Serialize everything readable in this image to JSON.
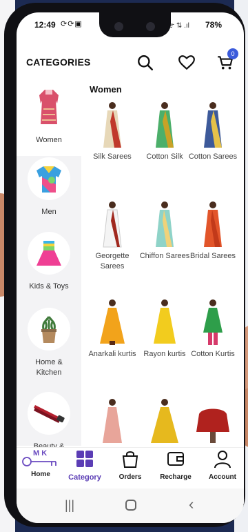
{
  "status": {
    "time": "12:49",
    "left_icons": "⟳⟳▣",
    "right_icons": "ᯤ ⇅ .ıl",
    "battery": "78%"
  },
  "header": {
    "title": "CATEGORIES",
    "cart_count": "0"
  },
  "sidebar": {
    "items": [
      {
        "label": "Women",
        "icon": "kurti-icon"
      },
      {
        "label": "Men",
        "icon": "tshirt-icon"
      },
      {
        "label": "Kids & Toys",
        "icon": "kids-dress-icon"
      },
      {
        "label": "Home & Kitchen",
        "icon": "plant-pot-icon"
      },
      {
        "label": "Beauty &",
        "icon": "hair-straightener-icon"
      }
    ]
  },
  "main": {
    "section_title": "Women",
    "products": [
      {
        "label": "Silk Sarees"
      },
      {
        "label": "Cotton Silk"
      },
      {
        "label": "Cotton Sarees"
      },
      {
        "label": "Georgette Sarees"
      },
      {
        "label": "Chiffon Sarees"
      },
      {
        "label": "Bridal Sarees"
      },
      {
        "label": "Anarkali kurtis"
      },
      {
        "label": "Rayon kurtis"
      },
      {
        "label": "Cotton Kurtis"
      }
    ]
  },
  "bottom_nav": {
    "logo_text": "M K",
    "items": [
      {
        "label": "Home"
      },
      {
        "label": "Category"
      },
      {
        "label": "Orders"
      },
      {
        "label": "Recharge"
      },
      {
        "label": "Account"
      }
    ]
  },
  "colors": {
    "accent": "#5b3db5",
    "badge": "#3b5bdb"
  }
}
